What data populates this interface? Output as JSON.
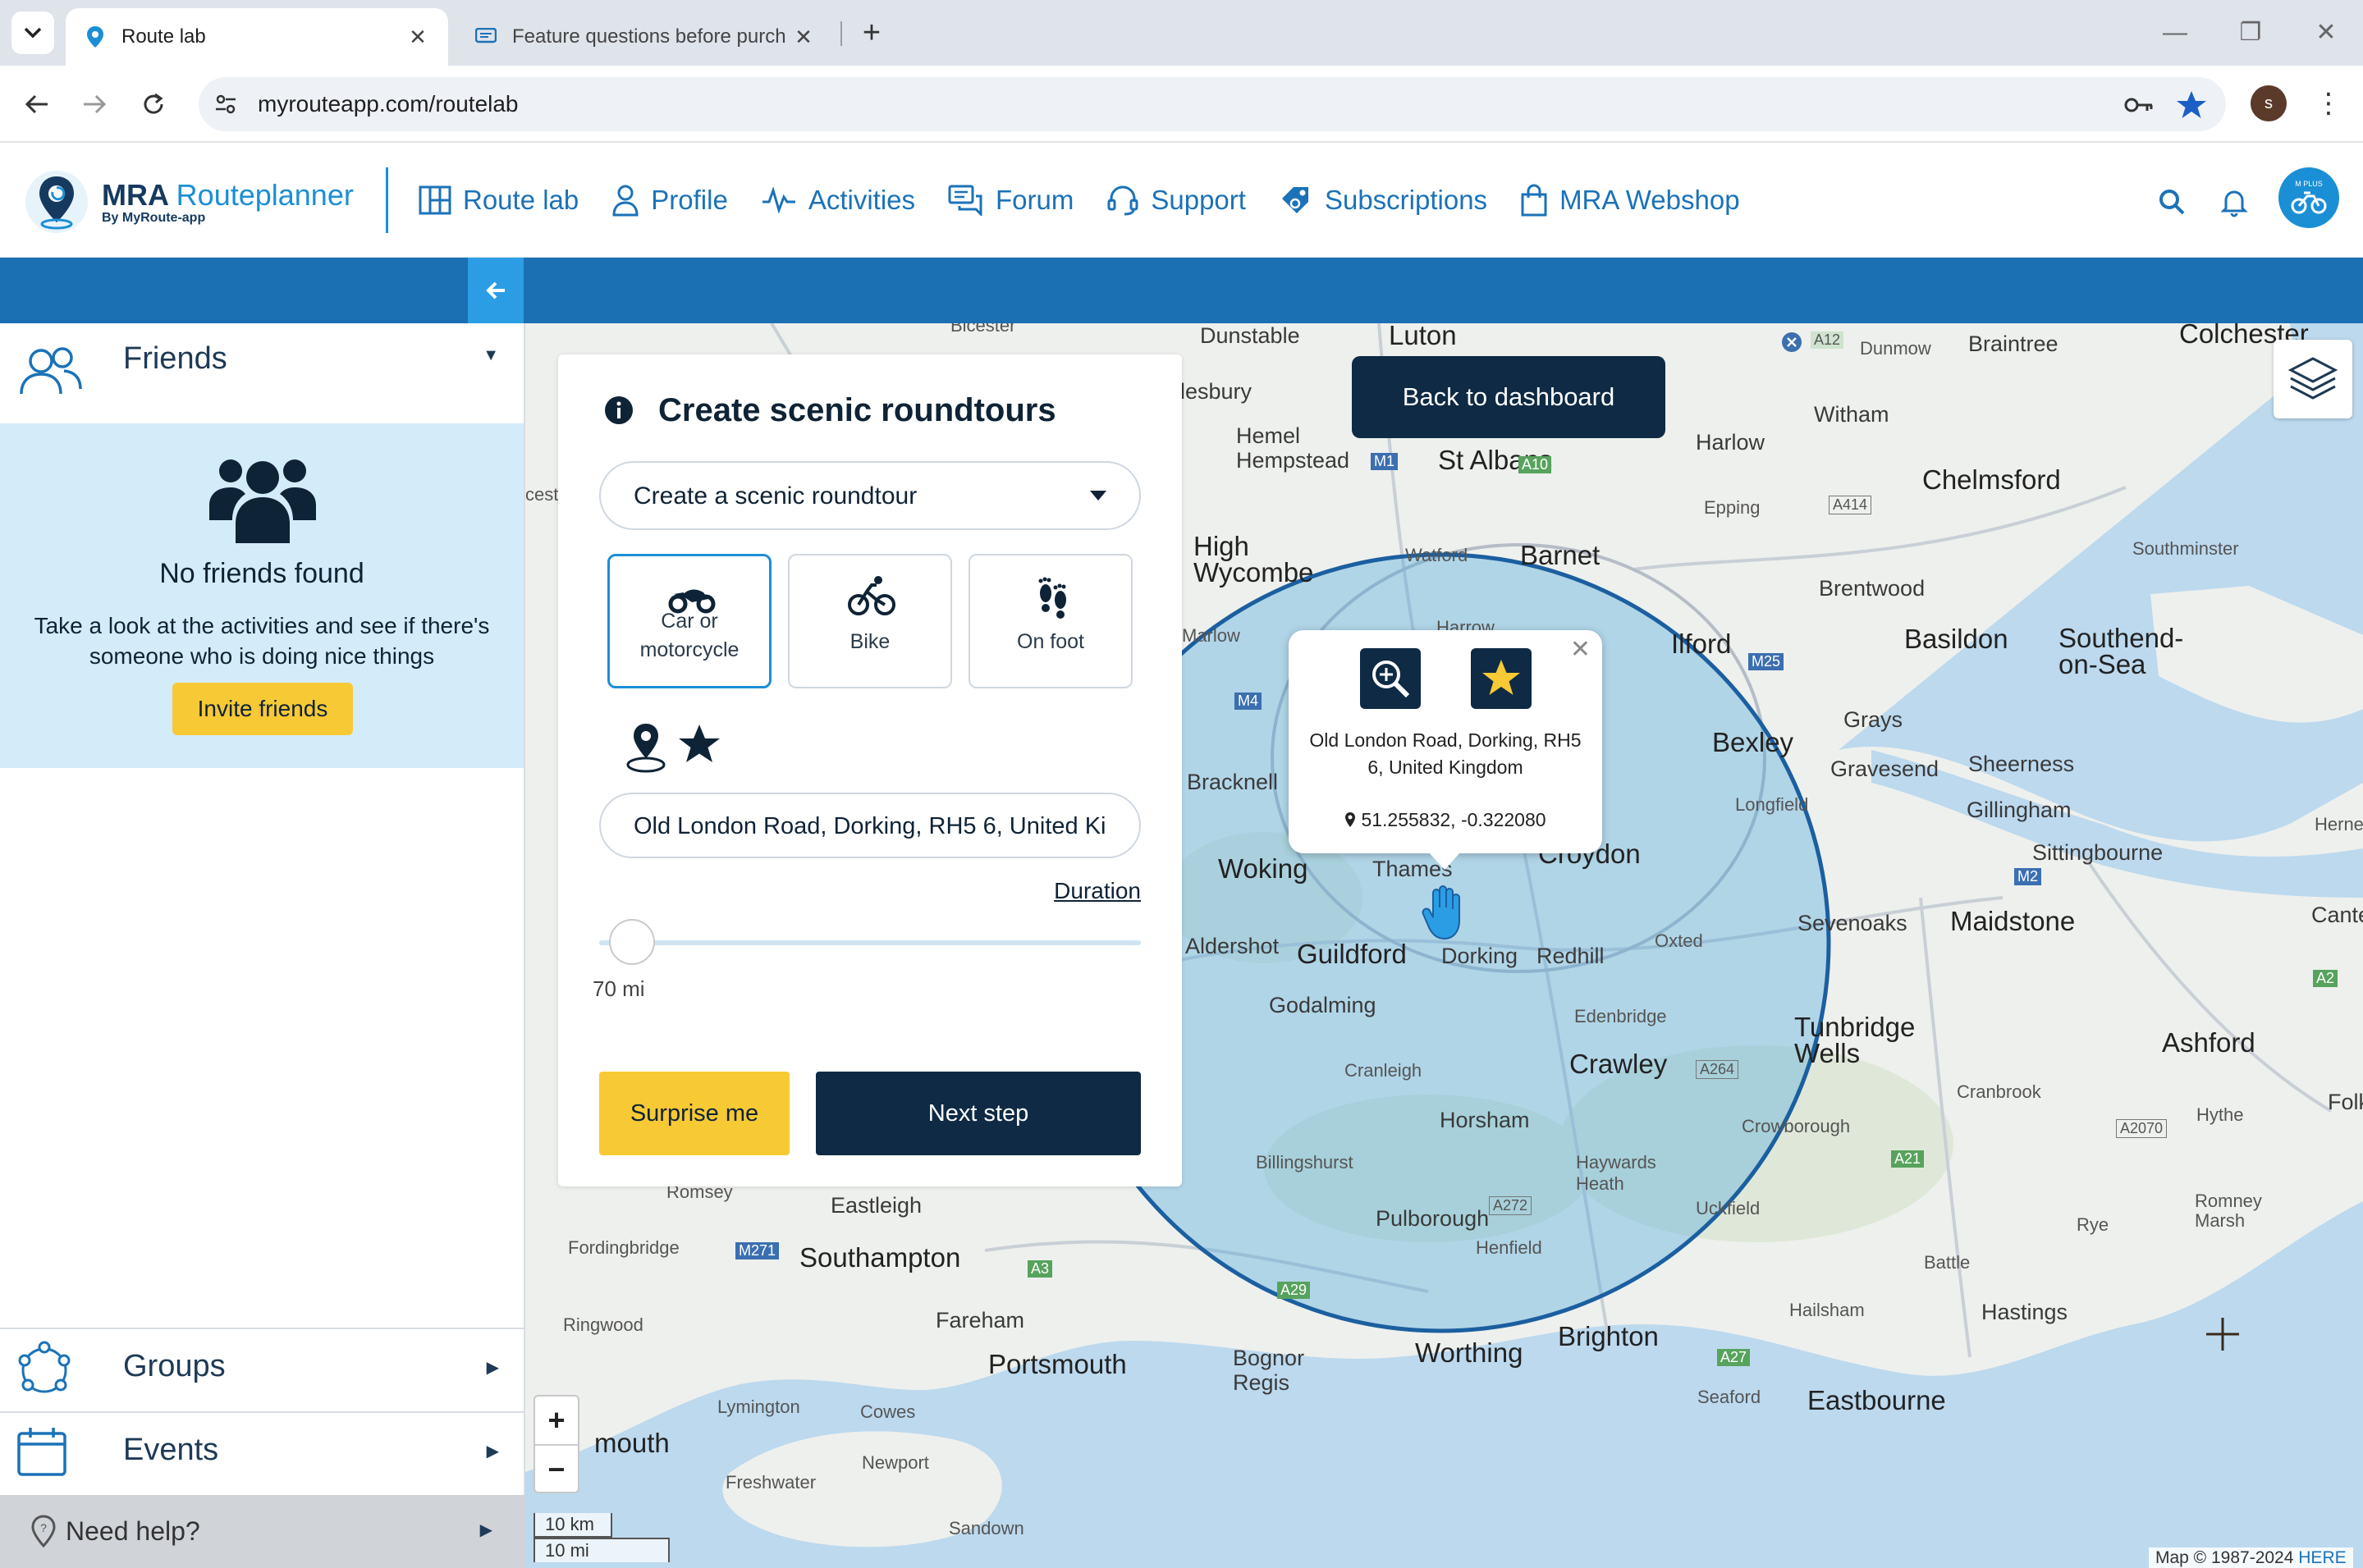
{
  "browser": {
    "tabs": [
      {
        "title": "Route lab",
        "active": true
      },
      {
        "title": "Feature questions before purch",
        "active": false
      }
    ],
    "new_tab": "+",
    "url": "myrouteapp.com/routelab",
    "profile_initial": "s"
  },
  "header": {
    "logo_title_bold": "MRA",
    "logo_title_light": "Routeplanner",
    "logo_sub": "By MyRoute-app",
    "nav": [
      {
        "label": "Route lab",
        "icon": "map-book-icon"
      },
      {
        "label": "Profile",
        "icon": "person-icon"
      },
      {
        "label": "Activities",
        "icon": "pulse-icon"
      },
      {
        "label": "Forum",
        "icon": "chat-icon"
      },
      {
        "label": "Support",
        "icon": "headset-icon"
      },
      {
        "label": "Subscriptions",
        "icon": "tag-icon"
      },
      {
        "label": "MRA Webshop",
        "icon": "shopping-bag-icon"
      }
    ],
    "avatar_badge": "M PLUS"
  },
  "sidebar": {
    "friends": {
      "label": "Friends",
      "empty_title": "No friends found",
      "empty_text": "Take a look at the activities and see if there's someone who is doing nice things",
      "invite_label": "Invite friends"
    },
    "groups_label": "Groups",
    "events_label": "Events",
    "help_label": "Need help?"
  },
  "panel": {
    "title": "Create scenic roundtours",
    "mode_value": "Create a scenic roundtour",
    "vehicles": [
      {
        "label": "Car or motorcycle",
        "selected": true
      },
      {
        "label": "Bike",
        "selected": false
      },
      {
        "label": "On foot",
        "selected": false
      }
    ],
    "location_value": "Old London Road, Dorking, RH5 6, United Ki",
    "duration_link": "Duration",
    "slider_value_label": "70 mi",
    "slider_fraction": 0.0,
    "surprise_label": "Surprise me",
    "next_label": "Next step"
  },
  "map": {
    "back_label": "Back to dashboard",
    "popup": {
      "address": "Old London Road, Dorking, RH5 6, United Kingdom",
      "coords": "51.255832, -0.322080"
    },
    "zoom_in": "+",
    "zoom_out": "−",
    "scale_km": "10 km",
    "scale_mi": "10 mi",
    "attribution": "Map © 1987-2024",
    "attribution_link": "HERE",
    "places": [
      "Dunstable",
      "Luton",
      "Colchester",
      "Braintree",
      "Dunmow",
      "Hemel Hempstead",
      "St Albans",
      "Harlow",
      "Witham",
      "Chelmsford",
      "Epping",
      "Barnet",
      "Watford",
      "High Wycombe",
      "Brentwood",
      "Southminster",
      "Basildon",
      "Southend-on-Sea",
      "Bexley",
      "Grays",
      "Gravesend",
      "Sheerness",
      "Gillingham",
      "Sittingbourne",
      "Croydon",
      "Woking",
      "Bracknell",
      "Guildford",
      "Dorking",
      "Redhill",
      "Oxted",
      "Sevenoaks",
      "Maidstone",
      "Aldershot",
      "Godalming",
      "Edenbridge",
      "Tunbridge Wells",
      "Ashford",
      "Crawley",
      "Cranleigh",
      "Horsham",
      "Cranbrook",
      "Crowborough",
      "Hythe",
      "Billingshurst",
      "Haywards Heath",
      "Romney Marsh",
      "Eastleigh",
      "Romsey",
      "Fordingbridge",
      "Southampton",
      "Uckfield",
      "Pulborough",
      "Henfield",
      "Rye",
      "Battle",
      "Ringwood",
      "Fareham",
      "Portsmouth",
      "Lymington",
      "Cowes",
      "Newport",
      "Freshwater",
      "Sandown",
      "Worthing",
      "Brighton",
      "Bognor Regis",
      "Hailsham",
      "Hastings",
      "Seaford",
      "Eastbourne",
      "Thames",
      "Ilford",
      "Longfield",
      "Harrow",
      "Marlow",
      "Canterb",
      "Herne",
      "lesbury",
      "cest",
      "mouth",
      "Bicester",
      "Folk"
    ],
    "road_labels": [
      "A12",
      "A414",
      "M1",
      "A10",
      "M25",
      "M4",
      "M2",
      "A2",
      "A21",
      "A264",
      "A2070",
      "A272",
      "A3",
      "A29",
      "A27",
      "M271"
    ]
  }
}
